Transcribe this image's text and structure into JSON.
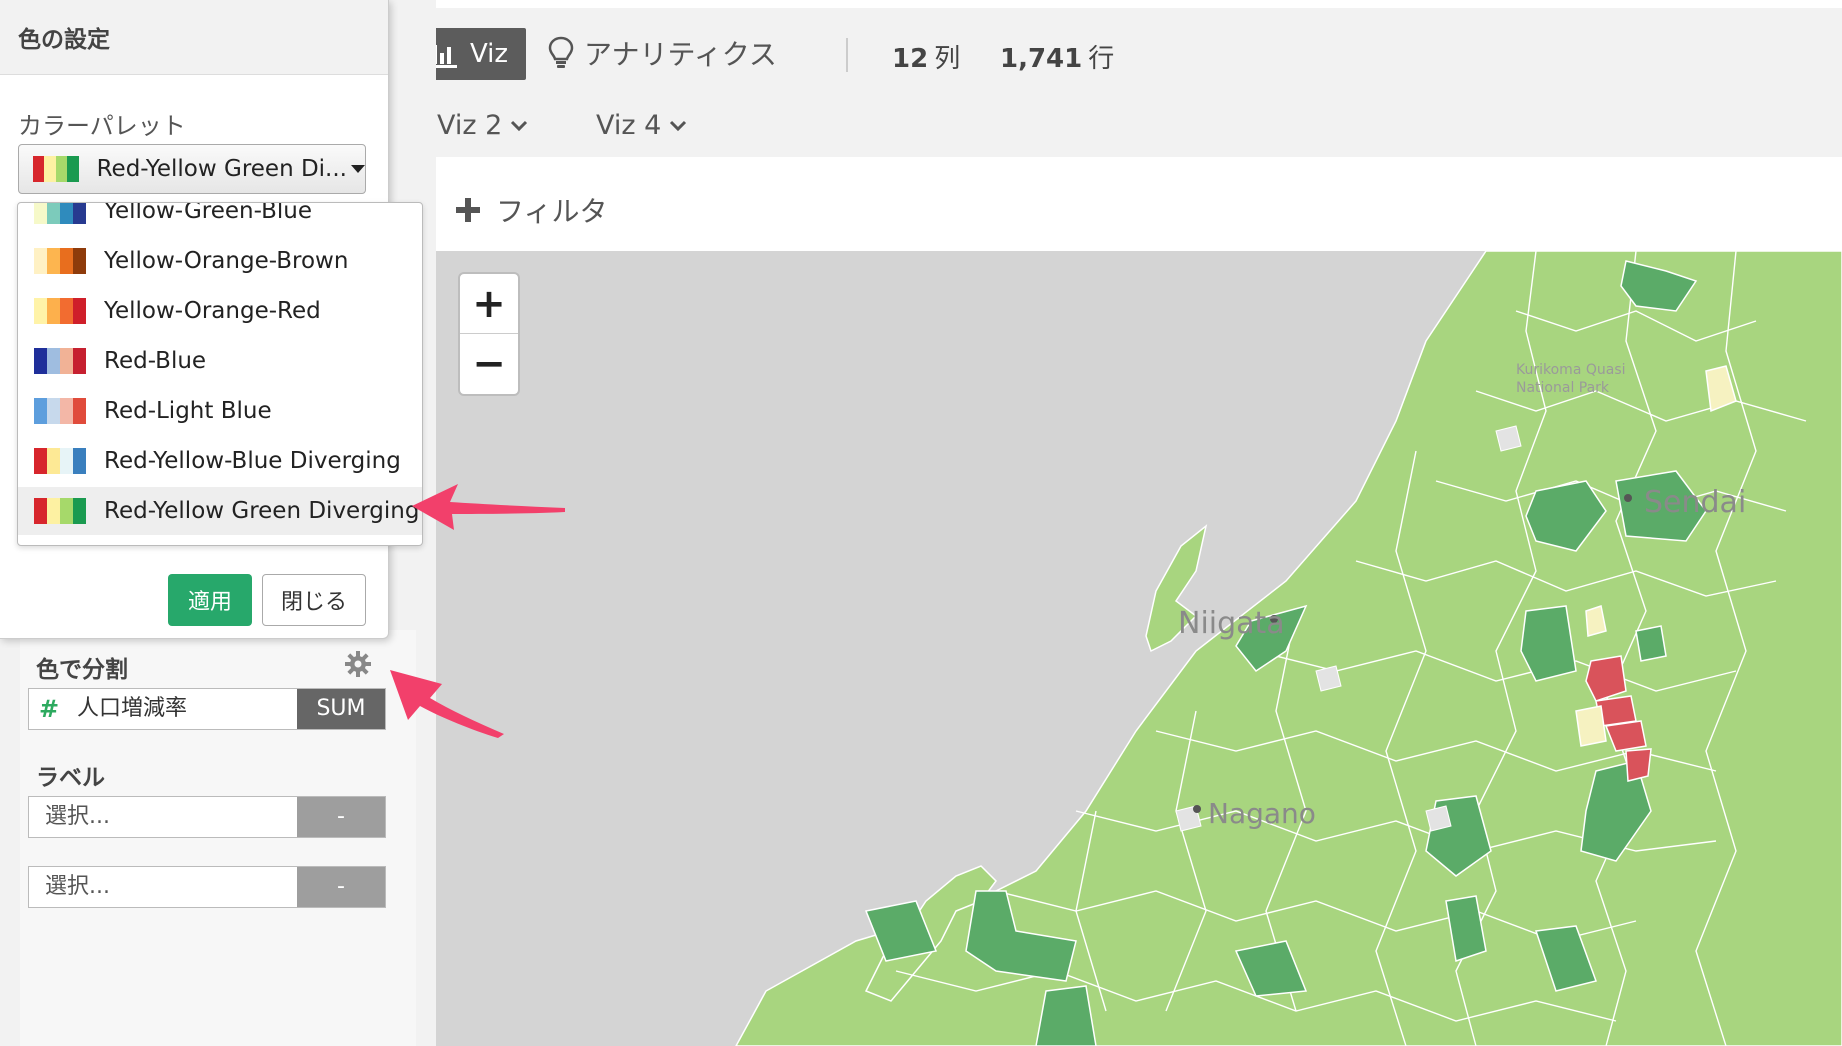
{
  "toolbar": {
    "viz_label": "Viz",
    "analytics_label": "アナリティクス",
    "columns_num": "12",
    "columns_unit": "列",
    "rows_num": "1,741",
    "rows_unit": "行",
    "viz_tabs": [
      "Viz 2",
      "Viz 4"
    ]
  },
  "filter": {
    "label": "フィルタ"
  },
  "map": {
    "labels": [
      "Niigata",
      "Sendai",
      "Nagano",
      "Kurikoma Quasi National Park"
    ],
    "zoom_in": "+",
    "zoom_out": "−"
  },
  "color_panel": {
    "title": "色の設定",
    "palette_label": "カラーパレット",
    "selected_palette": "Red-Yellow Green Di...",
    "options": [
      {
        "label": "Yellow-Green-Blue",
        "colors": [
          "#f6f9c9",
          "#7ccbbb",
          "#2f8bbd",
          "#273a90"
        ]
      },
      {
        "label": "Yellow-Orange-Brown",
        "colors": [
          "#fff1c4",
          "#fdb54f",
          "#e86e1e",
          "#8e3b0b"
        ]
      },
      {
        "label": "Yellow-Orange-Red",
        "colors": [
          "#fff3a8",
          "#fdb04c",
          "#f26c30",
          "#cf1f2a"
        ]
      },
      {
        "label": "Red-Blue",
        "colors": [
          "#1f2f9a",
          "#9fbde0",
          "#f1b296",
          "#c62030"
        ]
      },
      {
        "label": "Red-Light Blue",
        "colors": [
          "#5d9edd",
          "#c7d9ec",
          "#f3b7a7",
          "#e04b3b"
        ]
      },
      {
        "label": "Red-Yellow-Blue Diverging",
        "colors": [
          "#d7262c",
          "#fde995",
          "#e7f4f7",
          "#3a7fbe"
        ]
      },
      {
        "label": "Red-Yellow Green Diverging",
        "colors": [
          "#d7262c",
          "#fdf1a2",
          "#a6d96a",
          "#1a9a50"
        ]
      }
    ],
    "apply_label": "適用",
    "close_label": "閉じる"
  },
  "sidebar": {
    "color_split_label": "色で分割",
    "color_field": {
      "name": "人口増減率",
      "agg": "SUM"
    },
    "label_section": "ラベル",
    "label_selects": [
      "選択...",
      "選択..."
    ],
    "select_dash": "-"
  },
  "colors": {
    "apply_green": "#27a86b",
    "map_light_green": "#a8d57f",
    "map_dark_green": "#5bab68",
    "map_red": "#d9535b",
    "arrow_pink": "#f2406b"
  }
}
